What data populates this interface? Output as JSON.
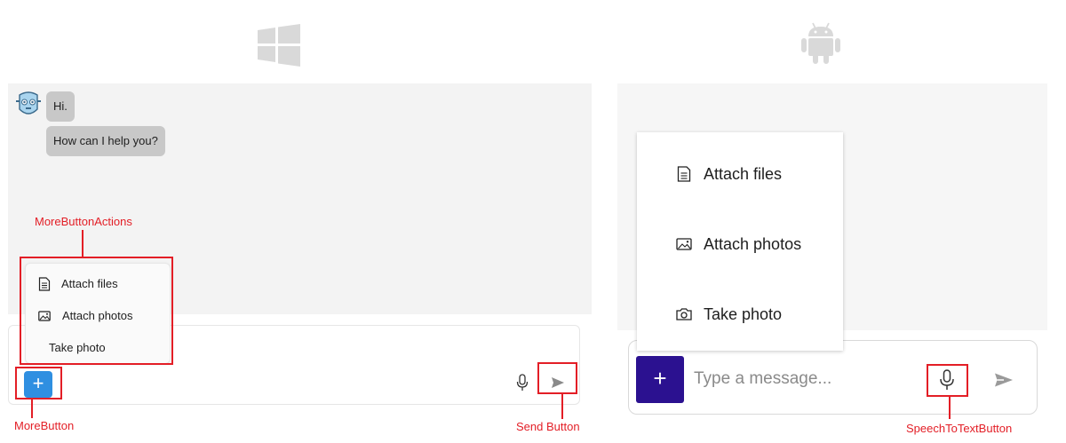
{
  "windows": {
    "platform_icon": "windows-logo-icon",
    "messages": [
      {
        "text": "Hi."
      },
      {
        "text": "How can I help you?"
      }
    ],
    "more_button_label": "+",
    "menu_items": [
      {
        "label": "Attach files",
        "icon": "document-icon"
      },
      {
        "label": "Attach photos",
        "icon": "image-icon"
      },
      {
        "label": "Take photo",
        "icon": ""
      }
    ],
    "annotations": {
      "more_button_actions": "MoreButtonActions",
      "more_button": "MoreButton",
      "send_button": "Send Button"
    }
  },
  "android": {
    "platform_icon": "android-logo-icon",
    "more_button_label": "+",
    "input_placeholder": "Type a message...",
    "menu_items": [
      {
        "label": "Attach files",
        "icon": "document-icon"
      },
      {
        "label": "Attach photos",
        "icon": "image-icon"
      },
      {
        "label": "Take photo",
        "icon": "camera-icon"
      }
    ],
    "annotations": {
      "speech_to_text_button": "SpeechToTextButton"
    }
  },
  "colors": {
    "annotation_red": "#e31e26",
    "windows_accent": "#2f8fe1",
    "android_accent": "#2b1190",
    "bubble_gray": "#c8c8c8"
  }
}
